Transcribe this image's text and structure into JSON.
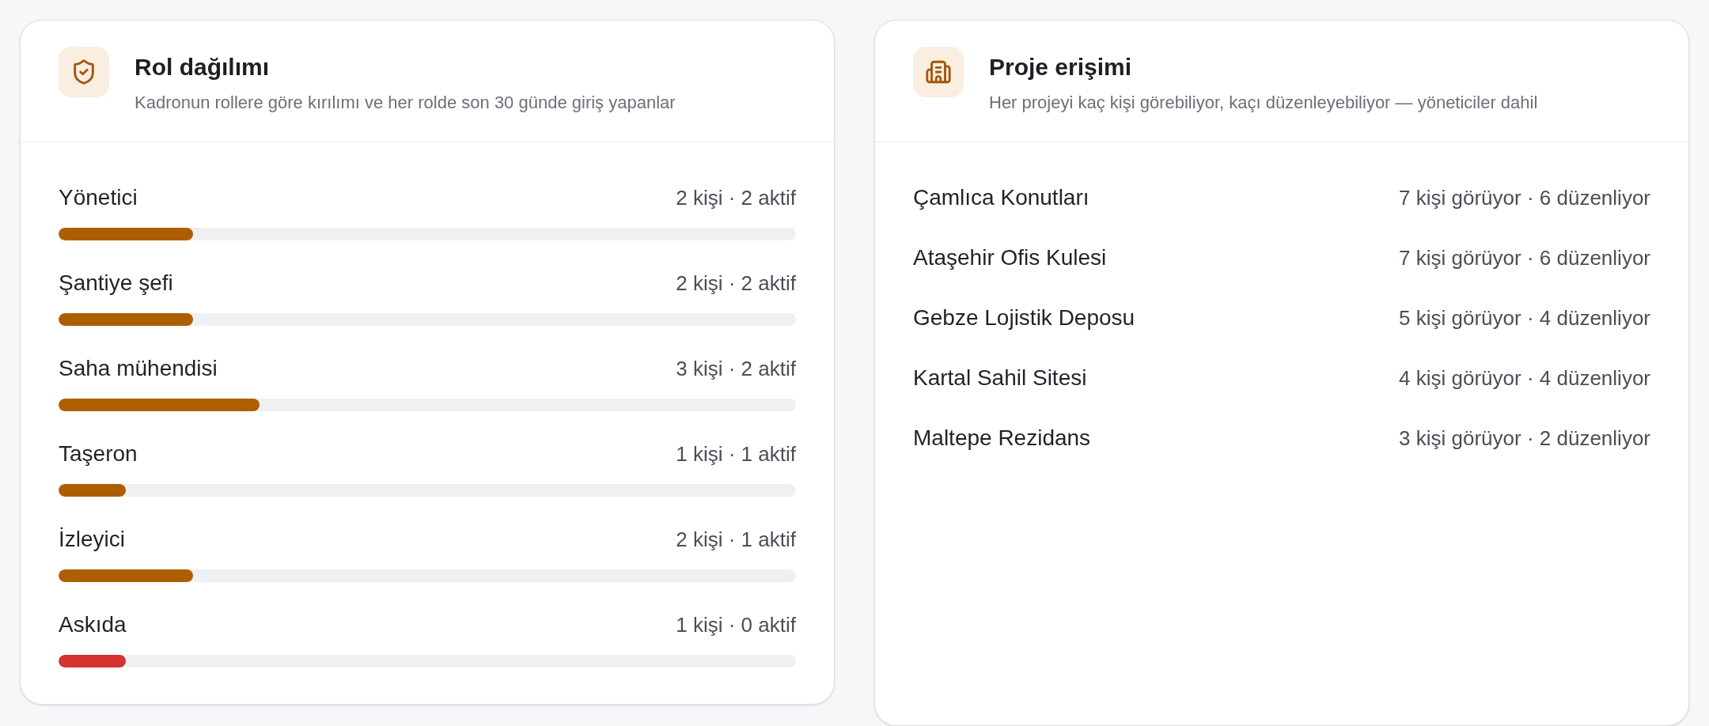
{
  "role_card": {
    "title": "Rol dağılımı",
    "subtitle": "Kadronun rollere göre kırılımı ve her rolde son 30 günde giriş yapanlar",
    "roles": [
      {
        "name": "Yönetici",
        "summary": "2 kişi · 2 aktif",
        "level": 0.182,
        "color": "#ad5f00"
      },
      {
        "name": "Şantiye şefi",
        "summary": "2 kişi · 2 aktif",
        "level": 0.182,
        "color": "#ad5f00"
      },
      {
        "name": "Saha mühendisi",
        "summary": "3 kişi · 2 aktif",
        "level": 0.273,
        "color": "#ad5f00"
      },
      {
        "name": "Taşeron",
        "summary": "1 kişi · 1 aktif",
        "level": 0.091,
        "color": "#ad5f00"
      },
      {
        "name": "İzleyici",
        "summary": "2 kişi · 1 aktif",
        "level": 0.182,
        "color": "#ad5f00"
      },
      {
        "name": "Askıda",
        "summary": "1 kişi · 0 aktif",
        "level": 0.091,
        "color": "#d43131"
      }
    ]
  },
  "project_card": {
    "title": "Proje erişimi",
    "subtitle": "Her projeyi kaç kişi görebiliyor, kaçı düzenleyebiliyor — yöneticiler dahil",
    "projects": [
      {
        "name": "Çamlıca Konutları",
        "summary": "7 kişi görüyor · 6 düzenliyor"
      },
      {
        "name": "Ataşehir Ofis Kulesi",
        "summary": "7 kişi görüyor · 6 düzenliyor"
      },
      {
        "name": "Gebze Lojistik Deposu",
        "summary": "5 kişi görüyor · 4 düzenliyor"
      },
      {
        "name": "Kartal Sahil Sitesi",
        "summary": "4 kişi görüyor · 4 düzenliyor"
      },
      {
        "name": "Maltepe Rezidans",
        "summary": "3 kişi görüyor · 2 düzenliyor"
      }
    ]
  }
}
